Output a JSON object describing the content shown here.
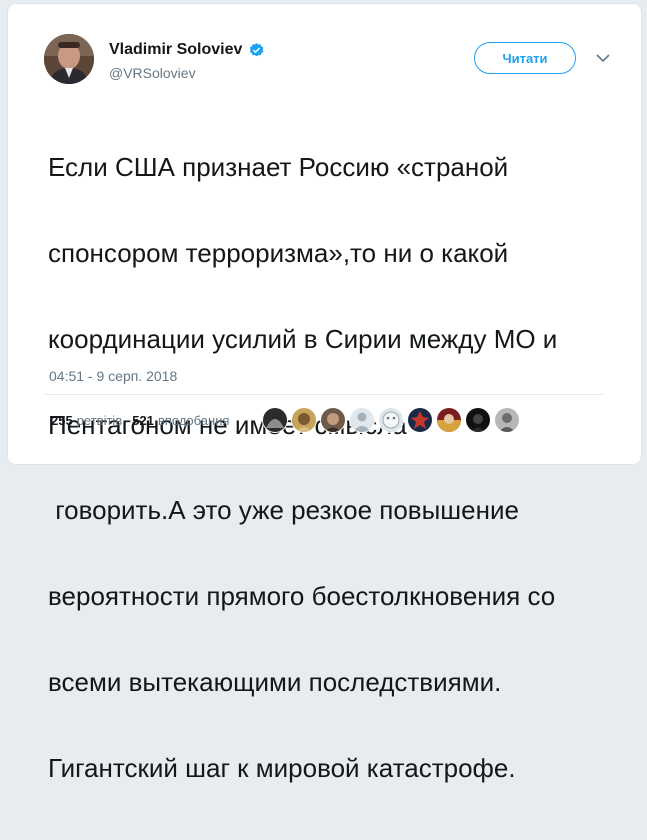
{
  "tweet": {
    "author": {
      "name": "Vladimir Soloviev",
      "handle": "@VRSoloviev"
    },
    "follow_label": "Читати",
    "text_lines": [
      "Если США признает Россию «страной",
      "спонсором терроризма»,то ни о какой",
      "координации усилий в Сирии между МО и",
      "Пентагоном не имеет смысла",
      " говорить.А это уже резкое повышение",
      "вероятности прямого боестолкновения со",
      "всеми вытекающими последствиями.",
      "Гигантский шаг к мировой катастрофе."
    ],
    "timestamp": "04:51 - 9 серп. 2018",
    "stats": {
      "retweets_count": "255",
      "retweets_label": "ретвітів",
      "likes_count": "521",
      "likes_label": "вподобання"
    }
  },
  "colors": {
    "accent": "#1da1f2",
    "text": "#14171a",
    "muted": "#657786"
  },
  "icons": {
    "verified": "verified-badge-icon",
    "menu": "chevron-down-icon"
  },
  "likers_count_shown": 9
}
